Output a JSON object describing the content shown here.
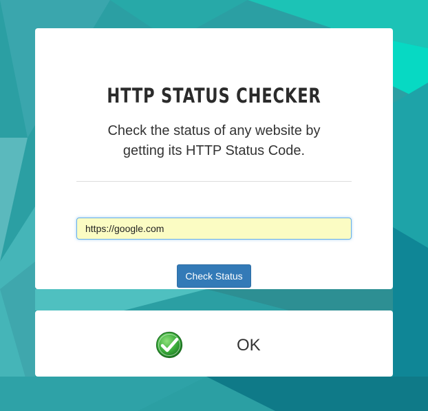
{
  "header": {
    "title": "HTTP STATUS CHECKER",
    "subtitle": "Check the status of any website by getting its HTTP Status Code."
  },
  "form": {
    "url_value": "https://google.com",
    "submit_label": "Check Status"
  },
  "result": {
    "icon": "green-checkmark-icon",
    "status_text": "OK"
  },
  "colors": {
    "primary_button": "#337ab7",
    "input_fill": "#fbfcc3",
    "success": "#3cae3c",
    "background_teal": "#2a9ea0"
  }
}
